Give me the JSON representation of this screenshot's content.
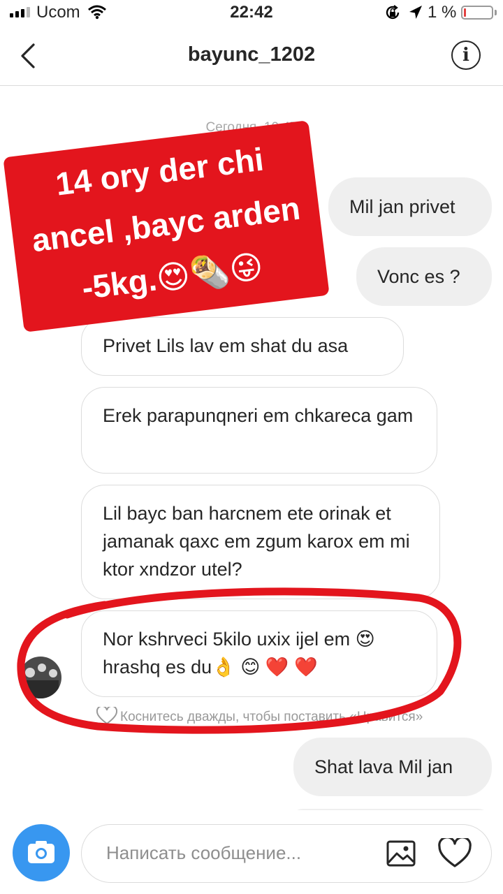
{
  "status_bar": {
    "carrier": "Ucom",
    "time": "22:42",
    "battery": "1 %",
    "battery_level": 0.01
  },
  "header": {
    "username": "bayunc_1202",
    "back_icon": "chevron-left-icon",
    "info_icon": "info-icon"
  },
  "timestamp": "Сегодня, 10:47",
  "overlay": {
    "lines": [
      "14 ory der chi",
      "ancel ,bayc arden",
      "-5kg.😍🌯😜"
    ],
    "color": "#e3151d"
  },
  "messages": [
    {
      "side": "out",
      "text": "Mil jan privet"
    },
    {
      "side": "out",
      "text": "Vonc es ?"
    },
    {
      "side": "in",
      "text": "Privet Lils lav em shat du asa"
    },
    {
      "side": "in",
      "text": "Erek parapunqneri em chkareca gam"
    },
    {
      "side": "in",
      "text": "Lil bayc ban harcnem ete orinak et jamanak qaxc em zgum karox em mi ktor xndzor utel?"
    },
    {
      "side": "in",
      "text": "Nor kshrveci 5kilo uxix ijel em 😍 hrashq es du👌 😊 ❤️ ❤️"
    },
    {
      "side": "out",
      "text": "Shat lava Mil jan"
    }
  ],
  "like_hint": "Коснитесь дважды, чтобы поставить «Нравится»",
  "composer": {
    "placeholder": "Написать сообщение...",
    "accent": "#3897f0"
  },
  "colors": {
    "outgoing_bubble": "#efefef",
    "incoming_border": "#dcdcdc",
    "annotation_circle": "#e3151d"
  }
}
